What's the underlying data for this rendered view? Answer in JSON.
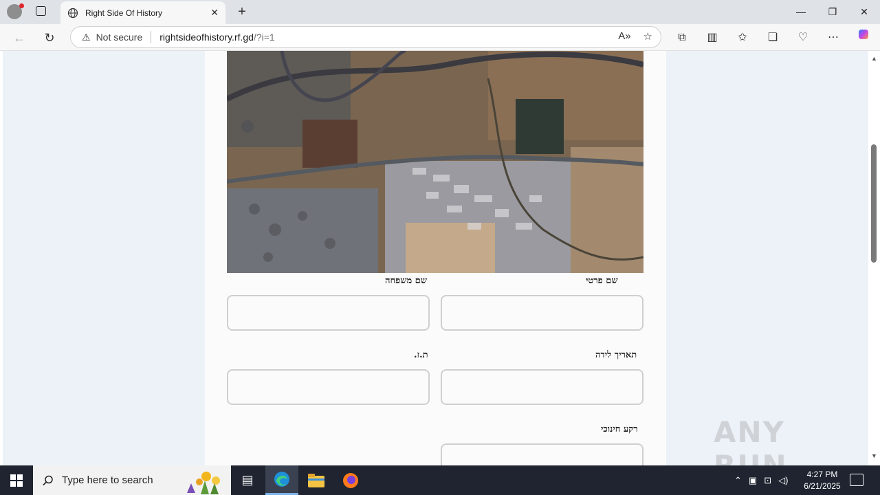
{
  "browser": {
    "tab_title": "Right Side Of History",
    "tab_close": "✕",
    "new_tab": "+",
    "minimize": "—",
    "restore": "❐",
    "close": "✕",
    "not_secure": "Not secure",
    "url_host": "rightsideofhistory.rf.gd",
    "url_path": "/?i=1",
    "back": "←",
    "reload": "↻"
  },
  "form": {
    "first_name_label": "שם פרטי",
    "last_name_label": "שם משפחה",
    "birth_date_label": "תאריך לידה",
    "id_label": "ת.ז.",
    "education_label": "רקע חינוכי"
  },
  "watermark": "ANY RUN",
  "taskbar": {
    "search_placeholder": "Type here to search",
    "time": "4:27 PM",
    "date": "6/21/2025"
  }
}
